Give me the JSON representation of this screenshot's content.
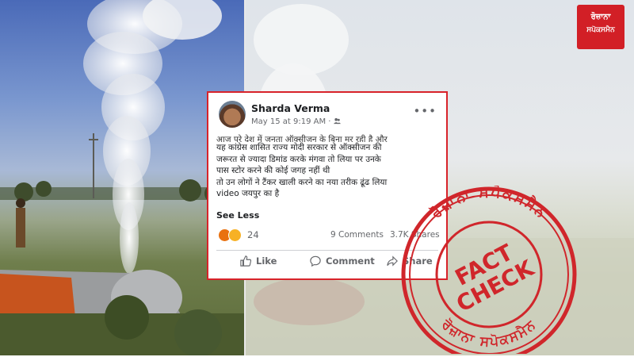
{
  "post": {
    "author": "Sharda Verma",
    "timestamp": "May 15 at 9:19 AM",
    "privacy_separator": "·",
    "cut_line": "आज पूरे देश में जनता ऑक्सीजन के बिना मर रही है और",
    "body_lines": [
      "यह कांग्रेस शासित राज्य मोदी सरकार से ऑक्सीजन की",
      "जरूरत से ज्यादा डिमांड करके मंगवा तो लिया पर उनके",
      "पास स्टोर करने की कोई जगह नहीं थी",
      "तो उन लोगों ने टैंकर खाली करने का नया तरीक ढूंढ लिया",
      "video जयपुर का है"
    ],
    "see_less": "See Less",
    "reaction_count": "24",
    "comments": "9 Comments",
    "shares": "3.7K Shares",
    "actions": {
      "like": "Like",
      "comment": "Comment",
      "share": "Share"
    }
  },
  "logo": {
    "line1": "ਰੋਜ਼ਾਨਾ",
    "line2": "ਸਪੋਕਸਮੈਨ"
  },
  "stamp": {
    "line1": "FACT",
    "line2": "CHECK",
    "ring_top": "ਰੋਜ਼ਾਨਾ ਸਪੋਕਸਮੈਨ",
    "ring_bottom": "ਰੋਜ਼ਾਨਾ ਸਪੋਕਸਮੈਨ",
    "color": "#d0262b"
  }
}
